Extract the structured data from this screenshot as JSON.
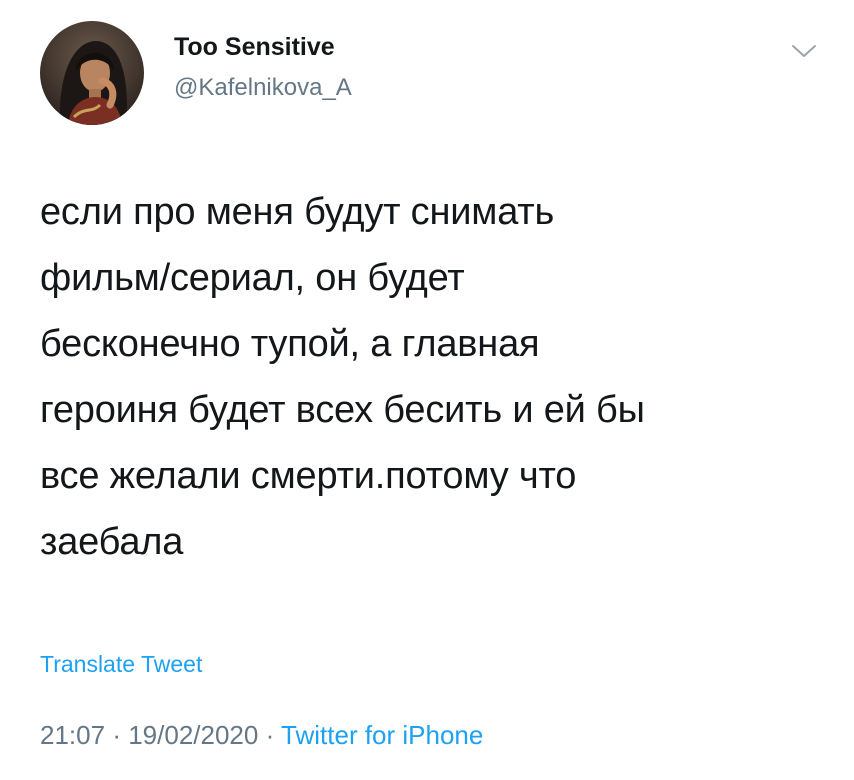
{
  "user": {
    "display_name": "Too Sensitive",
    "handle": "@Kafelnikova_A"
  },
  "icons": {
    "avatar": "profile-photo",
    "menu": "chevron-down-icon"
  },
  "tweet": {
    "lines": [
      "если про меня будут снимать",
      "фильм/сериал, он будет",
      "бесконечно тупой, а главная",
      "героиня будет всех бесить и ей бы",
      "все желали смерти.потому что",
      "заебала"
    ],
    "translate_label": "Translate Tweet"
  },
  "meta": {
    "time": "21:07",
    "separator": "·",
    "date": "19/02/2020",
    "source": "Twitter for iPhone"
  },
  "colors": {
    "text": "#14171a",
    "secondary": "#657786",
    "accent": "#1da1f2"
  }
}
